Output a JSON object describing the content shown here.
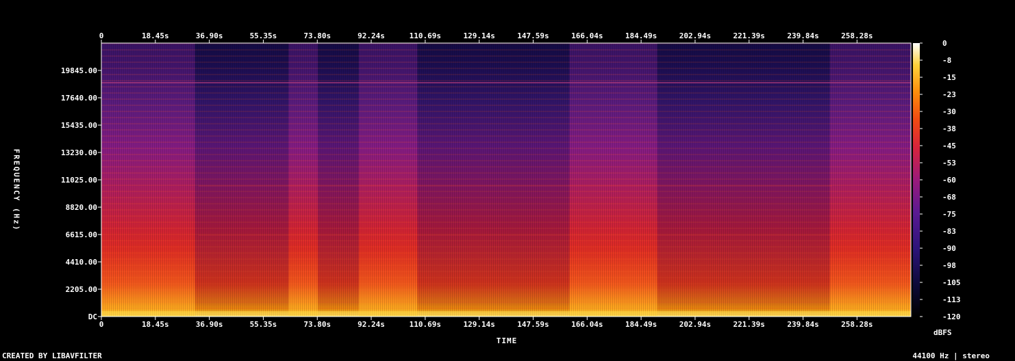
{
  "chart_data": {
    "type": "heatmap",
    "kind": "spectrogram",
    "xlabel": "TIME",
    "ylabel": "FREQUENCY (Hz)",
    "colorbar_label": "dBFS",
    "x_ticks": [
      "0",
      "18.45s",
      "36.90s",
      "55.35s",
      "73.80s",
      "92.24s",
      "110.69s",
      "129.14s",
      "147.59s",
      "166.04s",
      "184.49s",
      "202.94s",
      "221.39s",
      "239.84s",
      "258.28s"
    ],
    "x_tick_values": [
      0,
      18.45,
      36.9,
      55.35,
      73.8,
      92.24,
      110.69,
      129.14,
      147.59,
      166.04,
      184.49,
      202.94,
      221.39,
      239.84,
      258.28
    ],
    "xlim": [
      0,
      276.7
    ],
    "y_ticks": [
      "DC",
      "2205.00",
      "4410.00",
      "6615.00",
      "8820.00",
      "11025.00",
      "13230.00",
      "15435.00",
      "17640.00",
      "19845.00"
    ],
    "y_tick_values": [
      0,
      2205,
      4410,
      6615,
      8820,
      11025,
      13230,
      15435,
      17640,
      19845
    ],
    "ylim": [
      0,
      22050
    ],
    "colorbar_ticks": [
      "0",
      "-8",
      "-15",
      "-23",
      "-30",
      "-38",
      "-45",
      "-53",
      "-60",
      "-68",
      "-75",
      "-83",
      "-90",
      "-98",
      "-105",
      "-113",
      "-120"
    ],
    "colorbar_range": [
      -120,
      0
    ],
    "colormap": [
      "#000000",
      "#1a0a4a",
      "#3c1a82",
      "#6b1a8c",
      "#a01a6e",
      "#d8242a",
      "#f0520f",
      "#fc9a0c",
      "#fde03a",
      "#ffffff"
    ],
    "loud_sections_s": [
      [
        0,
        32
      ],
      [
        64,
        74
      ],
      [
        88,
        108
      ],
      [
        160,
        190
      ],
      [
        249,
        276.7
      ]
    ]
  },
  "footer": {
    "left": "CREATED BY LIBAVFILTER",
    "right": "44100 Hz | stereo"
  }
}
